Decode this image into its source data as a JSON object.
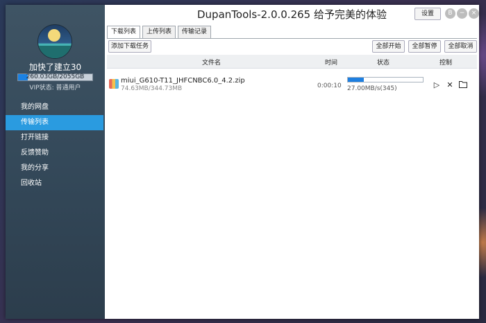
{
  "window": {
    "title": "DupanTools-2.0.0.265 给予完美的体验",
    "settings_label": "设置"
  },
  "user": {
    "name": "加快了建立30",
    "quota_text": "260.03GB/2055GB",
    "quota_used_fraction": 0.127,
    "vip_text": "VIP状态: 普通用户"
  },
  "sidebar": {
    "items": [
      {
        "label": "我的网盘",
        "active": false
      },
      {
        "label": "传输列表",
        "active": true
      },
      {
        "label": "打开链接",
        "active": false
      },
      {
        "label": "反馈赞助",
        "active": false
      },
      {
        "label": "我的分享",
        "active": false
      },
      {
        "label": "回收站",
        "active": false
      }
    ]
  },
  "tabs": [
    {
      "label": "下载列表",
      "active": true
    },
    {
      "label": "上传列表",
      "active": false
    },
    {
      "label": "传输记录",
      "active": false
    }
  ],
  "toolbar": {
    "add_task": "添加下载任务",
    "start_all": "全部开始",
    "pause_all": "全部暂停",
    "cancel_all": "全部取消"
  },
  "table": {
    "headers": {
      "name": "文件名",
      "time": "时间",
      "status": "状态",
      "control": "控制"
    },
    "rows": [
      {
        "file_name": "miui_G610-T11_JHFCNBC6.0_4.2.zip",
        "size": "74.63MB/344.73MB",
        "time": "0:00:10",
        "progress_fraction": 0.2165,
        "speed": "27.00MB/s(345)"
      }
    ]
  },
  "icons": {
    "zip": "zip-file-icon",
    "play": "play-icon",
    "close": "close-icon",
    "folder": "folder-icon"
  },
  "colors": {
    "accent": "#2a9be0",
    "progress": "#1e7fe0",
    "sidebar_bg": "#34495a"
  }
}
